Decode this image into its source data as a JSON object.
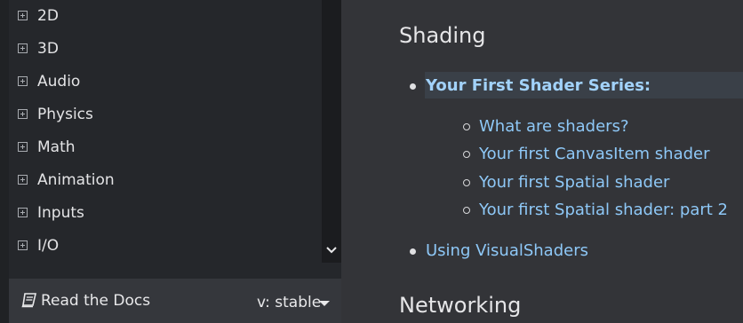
{
  "sidebar": {
    "items": [
      {
        "label": "2D"
      },
      {
        "label": "3D"
      },
      {
        "label": "Audio"
      },
      {
        "label": "Physics"
      },
      {
        "label": "Math"
      },
      {
        "label": "Animation"
      },
      {
        "label": "Inputs"
      },
      {
        "label": "I/O"
      }
    ]
  },
  "footer": {
    "read_the_docs": "Read the Docs",
    "version": "v: stable"
  },
  "content": {
    "shading_heading": "Shading",
    "shader_series": "Your First Shader Series:",
    "sub_links": [
      "What are shaders?",
      "Your first CanvasItem shader",
      "Your first Spatial shader",
      "Your first Spatial shader: part 2"
    ],
    "visual_shaders": "Using VisualShaders",
    "networking_heading": "Networking"
  },
  "colors": {
    "link": "#8ec8f7",
    "sidebar_bg": "#25272b",
    "content_bg": "#333438"
  }
}
